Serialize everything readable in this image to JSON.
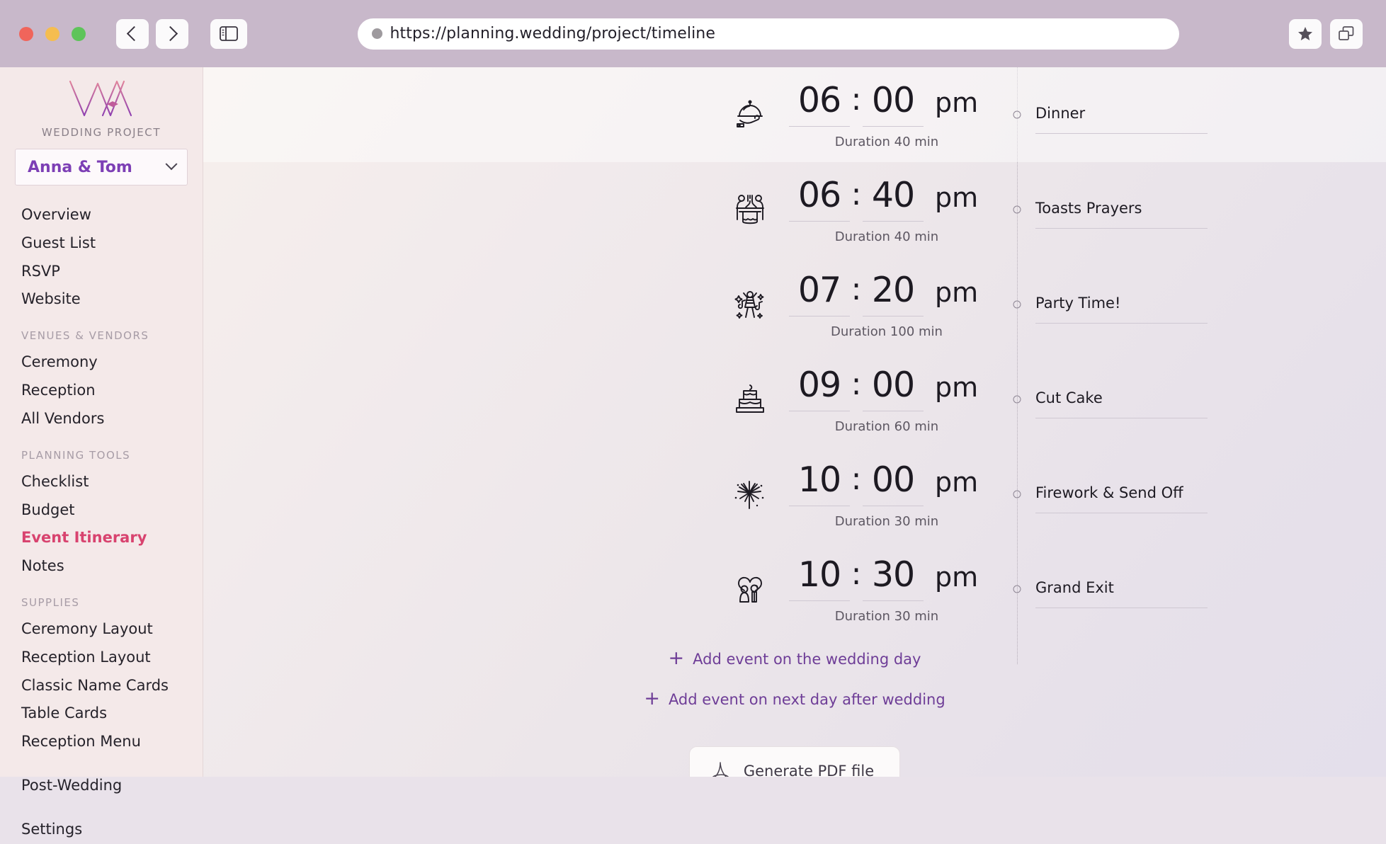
{
  "browser": {
    "url": "https://planning.wedding/project/timeline",
    "back_icon": "chevron-left-icon",
    "forward_icon": "chevron-right-icon",
    "sidebar_toggle_icon": "sidebar-panel-icon",
    "bookmark_icon": "star-icon",
    "tabs_icon": "duplicate-tabs-icon",
    "traffic_lights": [
      "close-red",
      "minimize-yellow",
      "maximize-green"
    ]
  },
  "sidebar": {
    "logo_alt": "WA",
    "brand_label": "WEDDING PROJECT",
    "project": {
      "name": "Anna & Tom",
      "chevron_icon": "chevron-down-icon"
    },
    "nav": [
      {
        "type": "item",
        "label": "Overview",
        "active": false
      },
      {
        "type": "item",
        "label": "Guest List",
        "active": false
      },
      {
        "type": "item",
        "label": "RSVP",
        "active": false
      },
      {
        "type": "item",
        "label": "Website",
        "active": false
      },
      {
        "type": "group",
        "label": "VENUES & VENDORS"
      },
      {
        "type": "item",
        "label": "Ceremony",
        "active": false
      },
      {
        "type": "item",
        "label": "Reception",
        "active": false
      },
      {
        "type": "item",
        "label": "All Vendors",
        "active": false
      },
      {
        "type": "group",
        "label": "PLANNING TOOLS"
      },
      {
        "type": "item",
        "label": "Checklist",
        "active": false
      },
      {
        "type": "item",
        "label": "Budget",
        "active": false
      },
      {
        "type": "item",
        "label": "Event Itinerary",
        "active": true
      },
      {
        "type": "item",
        "label": "Notes",
        "active": false
      },
      {
        "type": "group",
        "label": "SUPPLIES"
      },
      {
        "type": "item",
        "label": "Ceremony Layout",
        "active": false
      },
      {
        "type": "item",
        "label": "Reception Layout",
        "active": false
      },
      {
        "type": "item",
        "label": "Classic Name Cards",
        "active": false
      },
      {
        "type": "item",
        "label": "Table Cards",
        "active": false
      },
      {
        "type": "item",
        "label": "Reception Menu",
        "active": false
      },
      {
        "type": "spacer"
      },
      {
        "type": "item",
        "label": "Post-Wedding",
        "active": false
      },
      {
        "type": "spacer"
      },
      {
        "type": "item",
        "label": "Settings",
        "active": false
      }
    ]
  },
  "timeline": {
    "events": [
      {
        "icon": "cloche-service-icon",
        "hour": "06",
        "colon": ":",
        "minute": "00",
        "ampm": "pm",
        "duration": "Duration 40 min",
        "title": "Dinner",
        "highlight": true
      },
      {
        "icon": "banquet-table-icon",
        "hour": "06",
        "colon": ":",
        "minute": "40",
        "ampm": "pm",
        "duration": "Duration 40 min",
        "title": "Toasts Prayers",
        "highlight": false
      },
      {
        "icon": "dancing-person-icon",
        "hour": "07",
        "colon": ":",
        "minute": "20",
        "ampm": "pm",
        "duration": "Duration 100 min",
        "title": "Party Time!",
        "highlight": false
      },
      {
        "icon": "wedding-cake-icon",
        "hour": "09",
        "colon": ":",
        "minute": "00",
        "ampm": "pm",
        "duration": "Duration 60 min",
        "title": "Cut Cake",
        "highlight": false
      },
      {
        "icon": "firework-icon",
        "hour": "10",
        "colon": ":",
        "minute": "00",
        "ampm": "pm",
        "duration": "Duration 30 min",
        "title": "Firework & Send Off",
        "highlight": false
      },
      {
        "icon": "couple-heart-icon",
        "hour": "10",
        "colon": ":",
        "minute": "30",
        "ampm": "pm",
        "duration": "Duration 30 min",
        "title": "Grand Exit",
        "highlight": false
      }
    ],
    "add_wedding_day": "Add event on the wedding day",
    "add_next_day": "Add event on next day after wedding",
    "plus_glyph": "+",
    "generate_pdf": "Generate PDF file",
    "pdf_icon": "pdf-icon"
  },
  "colors": {
    "chrome": "#c8b8ca",
    "sidebar": "#f4e9e9",
    "accent_active": "#d8436f",
    "accent_link": "#6e3d97",
    "project_name": "#7d3fb5"
  }
}
